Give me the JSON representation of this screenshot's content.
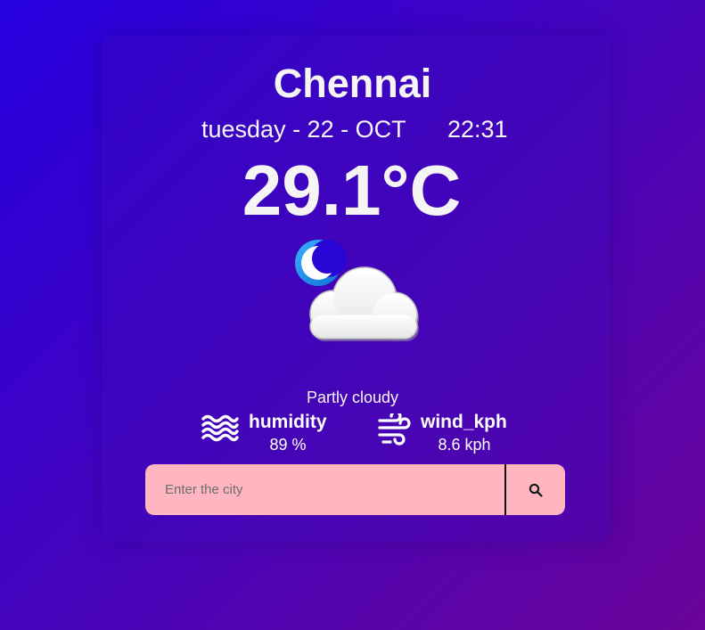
{
  "weather": {
    "city": "Chennai",
    "date": "tuesday - 22 - OCT",
    "time": "22:31",
    "temperature": "29.1°C",
    "condition": "Partly cloudy",
    "condition_icon": "moon-cloud-icon"
  },
  "stats": {
    "humidity": {
      "label": "humidity",
      "value": "89 %",
      "icon": "waves-icon"
    },
    "wind": {
      "label": "wind_kph",
      "value": "8.6 kph",
      "icon": "wind-icon"
    }
  },
  "search": {
    "placeholder": "Enter the city",
    "value": "",
    "button_icon": "search-icon"
  },
  "colors": {
    "background_start": "#2600e0",
    "background_end": "#6a0399",
    "search_bg": "#ffb6c1",
    "text": "#f5f5f5"
  }
}
